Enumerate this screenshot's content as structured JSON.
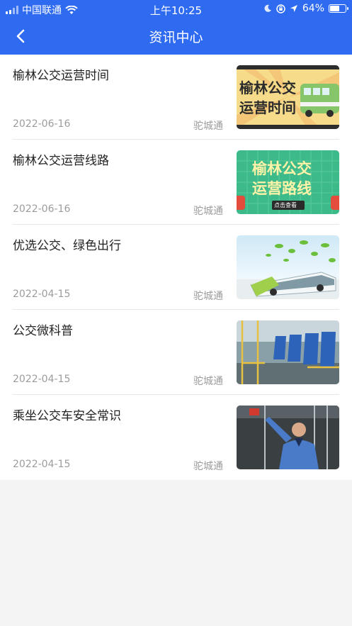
{
  "status": {
    "carrier": "中国联通",
    "time": "上午10:25",
    "battery": "64%",
    "battery_level": 0.64
  },
  "nav": {
    "title": "资讯中心",
    "back_icon": "chevron-left-icon"
  },
  "articles": [
    {
      "title": "榆林公交运营时间",
      "date": "2022-06-16",
      "source": "驼城通",
      "thumb_lines": [
        "榆林公交",
        "运营时间"
      ]
    },
    {
      "title": "榆林公交运营线路",
      "date": "2022-06-16",
      "source": "驼城通",
      "thumb_lines": [
        "榆林公交",
        "运营路线"
      ],
      "thumb_button": "点击查看"
    },
    {
      "title": "优选公交、绿色出行",
      "date": "2022-04-15",
      "source": "驼城通"
    },
    {
      "title": "公交微科普",
      "date": "2022-04-15",
      "source": "驼城通"
    },
    {
      "title": "乘坐公交车安全常识",
      "date": "2022-04-15",
      "source": "驼城通"
    }
  ],
  "colors": {
    "header": "#2f6bf0",
    "title_text": "#222222",
    "meta_text": "#9c9c9c"
  }
}
